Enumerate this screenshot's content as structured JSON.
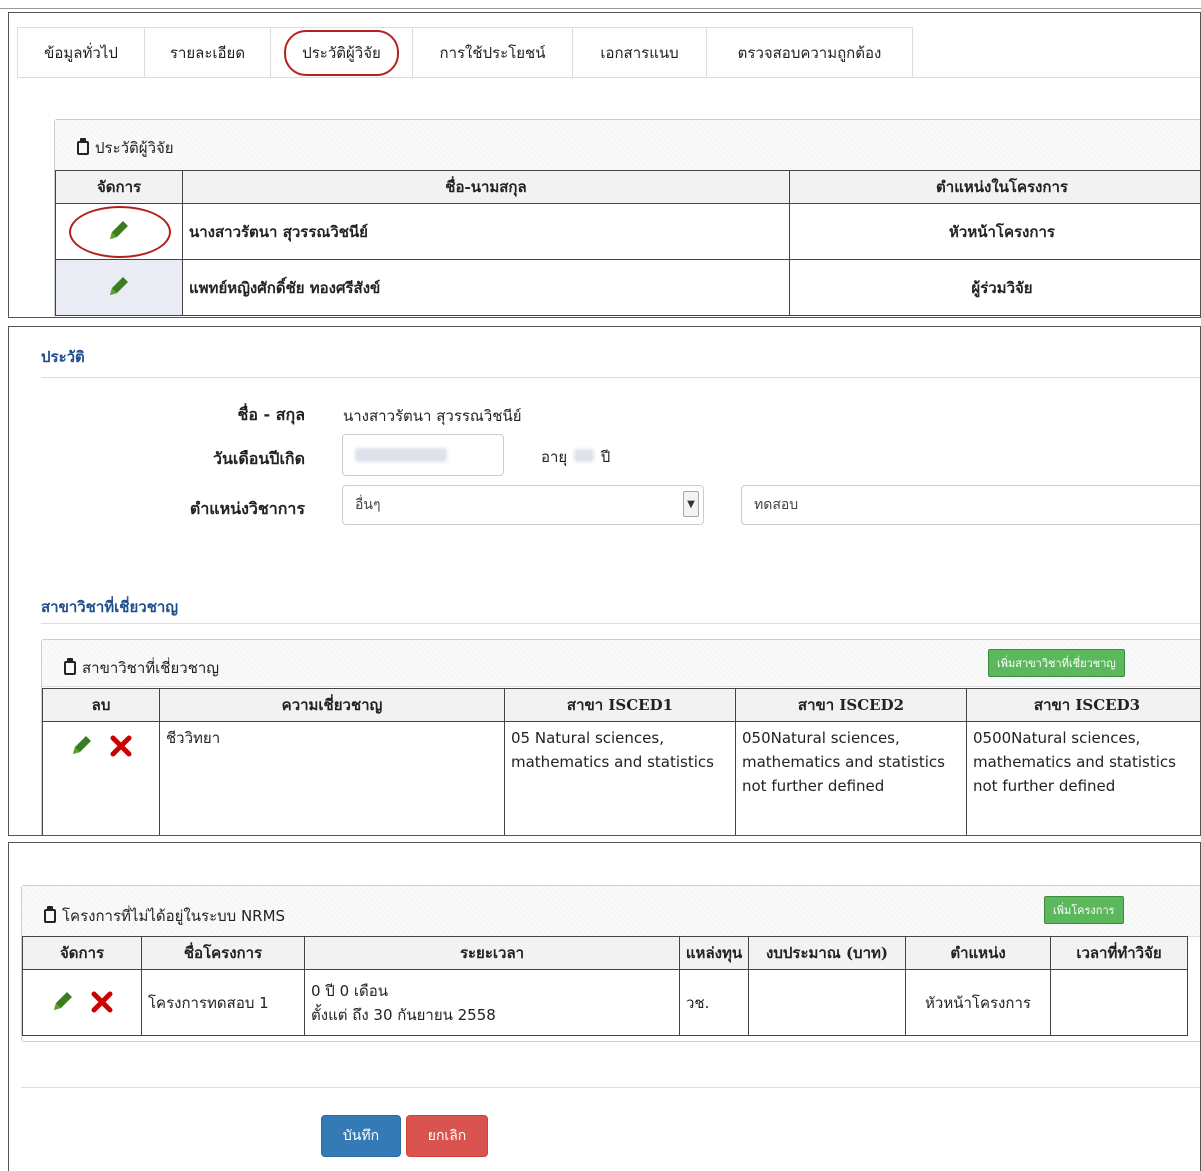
{
  "tabs": [
    {
      "label": "ข้อมูลทั่วไป",
      "active": false
    },
    {
      "label": "รายละเอียด",
      "active": false
    },
    {
      "label": "ประวัติผู้วิจัย",
      "active": true
    },
    {
      "label": "การใช้ประโยชน์",
      "active": false
    },
    {
      "label": "เอกสารแนบ",
      "active": false
    },
    {
      "label": "ตรวจสอบความถูกต้อง",
      "active": false
    }
  ],
  "researchers_panel": {
    "title": "ประวัติผู้วิจัย",
    "headers": [
      "จัดการ",
      "ชื่อ-นามสกุล",
      "ตำแหน่งในโครงการ"
    ],
    "rows": [
      {
        "name": "นางสาวรัตนา สุวรรณวิชนีย์",
        "role": "หัวหน้าโครงการ"
      },
      {
        "name": "แพทย์หญิงศักดิ์ชัย ทองศรีสังข์",
        "role": "ผู้ร่วมวิจัย"
      }
    ]
  },
  "profile": {
    "section_title": "ประวัติ",
    "name_label": "ชื่อ - สกุล",
    "name_value": "นางสาวรัตนา สุวรรณวิชนีย์",
    "birthdate_label": "วันเดือนปีเกิด",
    "age_label": "อายุ",
    "age_unit": "ปี",
    "position_label": "ตำแหน่งวิชาการ",
    "position_selected": "อื่นๆ",
    "position_other_value": "ทดสอบ"
  },
  "expertise": {
    "section_title": "สาขาวิชาที่เชี่ยวชาญ",
    "panel_title": "สาขาวิชาที่เชี่ยวชาญ",
    "add_button": "เพิ่มสาขาวิชาที่เชี่ยวชาญ",
    "headers": [
      "ลบ",
      "ความเชี่ยวชาญ",
      "สาขา ISCED1",
      "สาขา ISCED2",
      "สาขา ISCED3"
    ],
    "row": {
      "field": "ชีววิทยา",
      "isced1": "05 Natural sciences, mathematics and statistics",
      "isced2": "050Natural sciences, mathematics and statistics not further defined",
      "isced3": "0500Natural sciences, mathematics and statistics not further defined"
    }
  },
  "projects": {
    "panel_title": "โครงการที่ไม่ได้อยู่ในระบบ NRMS",
    "add_button": "เพิ่มโครงการ",
    "headers": [
      "จัดการ",
      "ชื่อโครงการ",
      "ระยะเวลา",
      "แหล่งทุน",
      "งบประมาณ (บาท)",
      "ตำแหน่ง",
      "เวลาที่ทำวิจัย"
    ],
    "row": {
      "name": "โครงการทดสอบ 1",
      "duration_line1": "0 ปี 0 เดือน",
      "duration_line2": "ตั้งแต่ ถึง 30 กันยายน 2558",
      "funding": "วช.",
      "budget": "",
      "position": "หัวหน้าโครงการ",
      "time": ""
    }
  },
  "actions": {
    "save": "บันทึก",
    "cancel": "ยกเลิก"
  },
  "colors": {
    "accent_green": "#5cb85c",
    "primary": "#337ab7",
    "danger": "#d9534f",
    "highlight_ring": "#b22222",
    "section_title": "#1f4e8c"
  }
}
